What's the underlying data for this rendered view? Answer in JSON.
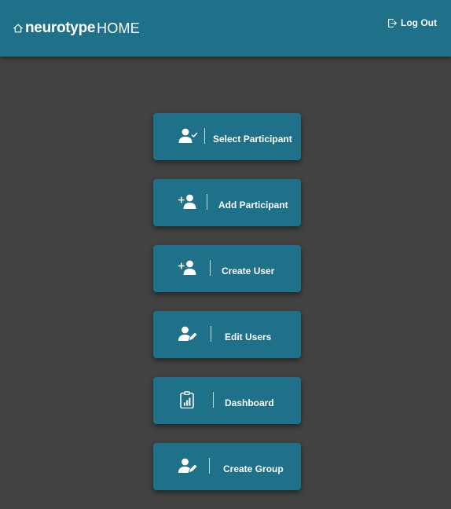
{
  "header": {
    "logo_text": "neurotype",
    "home_text": "HOME",
    "logout_label": "Log Out"
  },
  "menu": {
    "items": [
      {
        "label": "Select Participant",
        "icon": "user-check-icon"
      },
      {
        "label": "Add Participant",
        "icon": "user-plus-icon"
      },
      {
        "label": "Create User",
        "icon": "user-plus-icon"
      },
      {
        "label": "Edit Users",
        "icon": "user-edit-icon"
      },
      {
        "label": "Dashboard",
        "icon": "clipboard-chart-icon"
      },
      {
        "label": "Create Group",
        "icon": "user-edit-icon"
      }
    ]
  },
  "colors": {
    "background": "#424242",
    "header": "#1f7189",
    "button": "#1f7189",
    "text": "#ffffff"
  }
}
